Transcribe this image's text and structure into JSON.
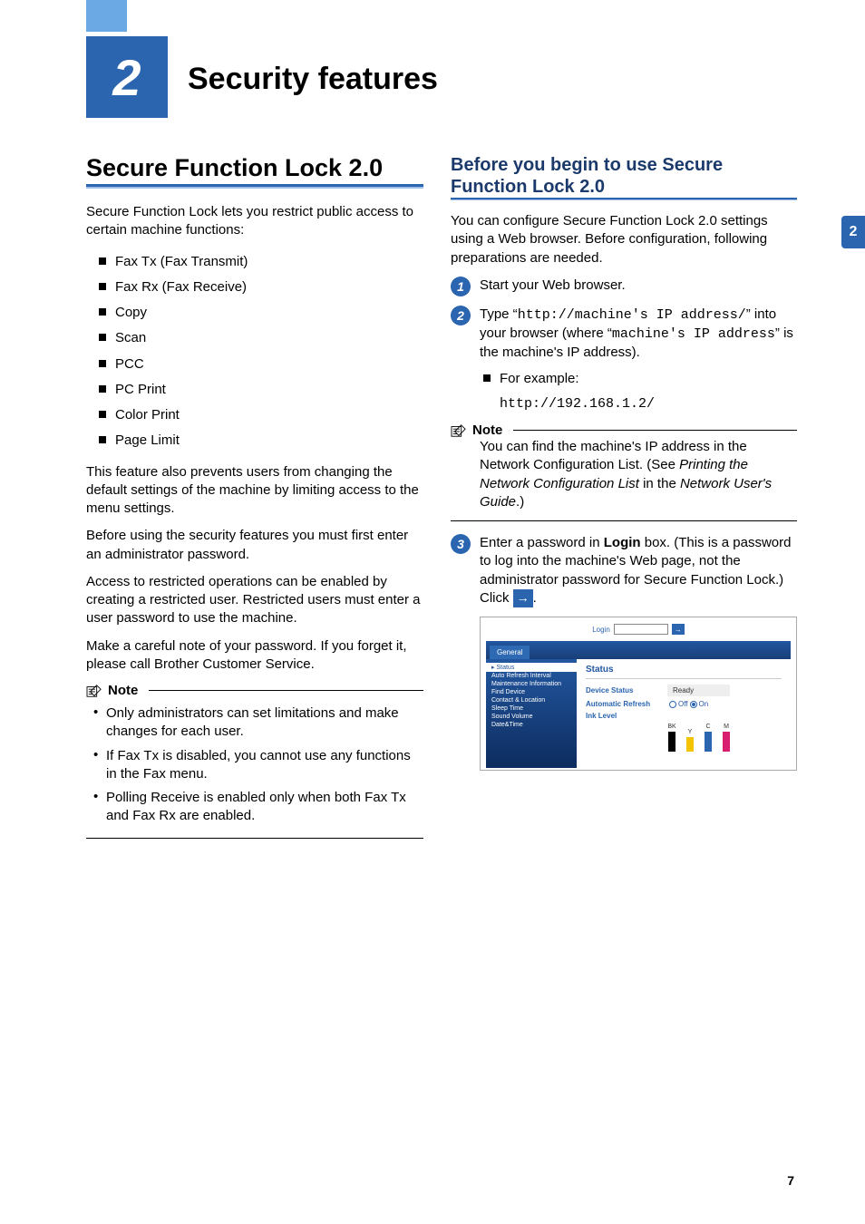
{
  "chapter": {
    "number": "2",
    "title": "Security features"
  },
  "side_thumb": "2",
  "page_number": "7",
  "left": {
    "h1": "Secure Function Lock 2.0",
    "intro": "Secure Function Lock lets you restrict public access to certain machine functions:",
    "functions": [
      "Fax Tx (Fax Transmit)",
      "Fax Rx (Fax Receive)",
      "Copy",
      "Scan",
      "PCC",
      "PC Print",
      "Color Print",
      "Page Limit"
    ],
    "para1": "This feature also prevents users from changing the default settings of the machine by limiting access to the menu settings.",
    "para2": "Before using the security features you must first enter an administrator password.",
    "para3": "Access to restricted operations can be enabled by creating a restricted user. Restricted users must enter a user password to use the machine.",
    "para4": "Make a careful note of your password. If you forget it, please call Brother Customer Service.",
    "note_label": "Note",
    "note_items": [
      "Only administrators can set limitations and make changes for each user.",
      "If Fax Tx is disabled, you cannot use any functions in the Fax menu.",
      "Polling Receive is enabled only when both Fax Tx and Fax Rx are enabled."
    ]
  },
  "right": {
    "h2": "Before you begin to use Secure Function Lock 2.0",
    "intro": "You can configure Secure Function Lock 2.0 settings using a Web browser. Before configuration, following preparations are needed.",
    "step1": "Start your Web browser.",
    "step2_a": "Type “",
    "step2_code1": "http://machine's IP address/",
    "step2_b": "” into your browser (where “",
    "step2_code2": "machine's IP address",
    "step2_c": "” is the machine's IP address).",
    "step2_example_label": "For example:",
    "step2_example_code": "http://192.168.1.2/",
    "note_label": "Note",
    "note_text_a": "You can find the machine's IP address in the Network Configuration List. (See ",
    "note_text_i": "Printing the Network Configuration List",
    "note_text_b": " in the ",
    "note_text_i2": "Network User's Guide",
    "note_text_c": ".)",
    "step3_a": "Enter a password in ",
    "step3_bold": "Login",
    "step3_b": " box. (This is a password to log into the machine's Web page, not the administrator password for Secure Function Lock.) Click ",
    "step3_c": ".",
    "screenshot": {
      "login_label": "Login",
      "tab": "General",
      "side_items": [
        "Status",
        "Auto Refresh Interval",
        "Maintenance Information",
        "Find Device",
        "Contact & Location",
        "Sleep Time",
        "Sound Volume",
        "Date&Time"
      ],
      "main_title": "Status",
      "device_status_label": "Device Status",
      "device_status_value": "Ready",
      "auto_refresh_label": "Automatic Refresh",
      "auto_refresh_off": "Off",
      "auto_refresh_on": "On",
      "ink_label": "Ink Level",
      "ink_labels": [
        "BK",
        "Y",
        "C",
        "M"
      ]
    }
  }
}
